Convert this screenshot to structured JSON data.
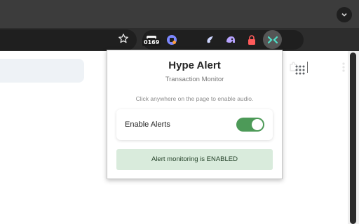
{
  "browser": {
    "extension_badge": "0169",
    "icons": [
      "star-icon",
      "extension-icon-1",
      "extension-icon-2",
      "extension-icon-3",
      "extension-icon-4",
      "lock-icon",
      "hype-alert-icon",
      "puzzle-icon",
      "menu-icon",
      "chevron-down-icon",
      "apps-grid-icon"
    ]
  },
  "popup": {
    "title": "Hype Alert",
    "subtitle": "Transaction Monitor",
    "hint": "Click anywhere on the page to enable audio.",
    "toggle_label": "Enable Alerts",
    "toggle_on": true,
    "status": "Alert monitoring is ENABLED"
  },
  "colors": {
    "toggle_on": "#4d9a58",
    "status_bg": "#d9ebdc",
    "status_text": "#1f3d24",
    "active_ext_icon": "#4fe0c8"
  }
}
